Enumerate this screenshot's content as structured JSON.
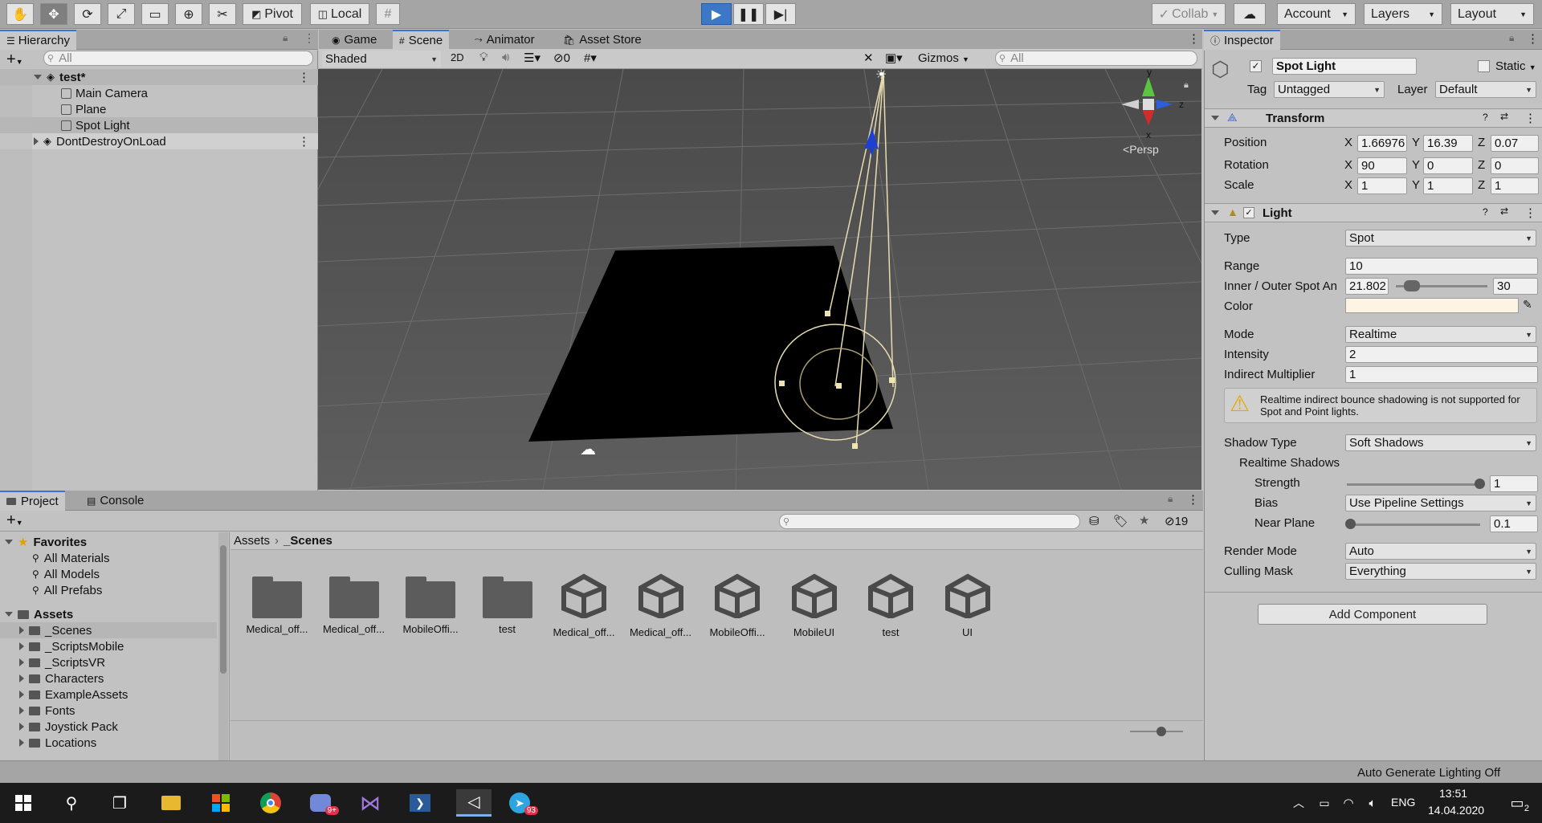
{
  "toolbar": {
    "pivot": "Pivot",
    "local": "Local",
    "collab": "Collab",
    "account": "Account",
    "layers": "Layers",
    "layout": "Layout"
  },
  "hierarchy": {
    "tab": "Hierarchy",
    "search_placeholder": "All",
    "scene": "test*",
    "items": [
      "Main Camera",
      "Plane",
      "Spot Light"
    ],
    "dont_destroy": "DontDestroyOnLoad"
  },
  "scene_view": {
    "tabs": [
      "Game",
      "Scene",
      "Animator",
      "Asset Store"
    ],
    "shading": "Shaded",
    "mode_2d": "2D",
    "hidden_count": "0",
    "gizmos": "Gizmos",
    "search_placeholder": "All",
    "persp": "Persp",
    "axis_labels": [
      "y",
      "z",
      "x"
    ]
  },
  "inspector": {
    "tab": "Inspector",
    "object_name": "Spot Light",
    "static_label": "Static",
    "tag_label": "Tag",
    "tag_value": "Untagged",
    "layer_label": "Layer",
    "layer_value": "Default",
    "transform": {
      "title": "Transform",
      "position_label": "Position",
      "rotation_label": "Rotation",
      "scale_label": "Scale",
      "position": [
        "1.66976",
        "16.39",
        "0.07"
      ],
      "rotation": [
        "90",
        "0",
        "0"
      ],
      "scale": [
        "1",
        "1",
        "1"
      ],
      "axes": [
        "X",
        "Y",
        "Z"
      ]
    },
    "light": {
      "title": "Light",
      "type_label": "Type",
      "type_value": "Spot",
      "range_label": "Range",
      "range_value": "10",
      "spot_label": "Inner / Outer Spot An",
      "inner_value": "21.802",
      "outer_value": "30",
      "color_label": "Color",
      "color_value": "#fdf4e3",
      "mode_label": "Mode",
      "mode_value": "Realtime",
      "intensity_label": "Intensity",
      "intensity_value": "2",
      "indirect_label": "Indirect Multiplier",
      "indirect_value": "1",
      "warning": "Realtime indirect bounce shadowing is not supported for Spot and Point lights.",
      "shadow_type_label": "Shadow Type",
      "shadow_type_value": "Soft Shadows",
      "realtime_shadows_label": "Realtime Shadows",
      "strength_label": "Strength",
      "strength_value": "1",
      "bias_label": "Bias",
      "bias_value": "Use Pipeline Settings",
      "near_plane_label": "Near Plane",
      "near_plane_value": "0.1",
      "render_mode_label": "Render Mode",
      "render_mode_value": "Auto",
      "culling_mask_label": "Culling Mask",
      "culling_mask_value": "Everything"
    },
    "add_component": "Add Component"
  },
  "project": {
    "tabs": [
      "Project",
      "Console"
    ],
    "hidden_count": "19",
    "favorites": "Favorites",
    "favorite_items": [
      "All Materials",
      "All Models",
      "All Prefabs"
    ],
    "assets": "Assets",
    "asset_folders": [
      "_Scenes",
      "_ScriptsMobile",
      "_ScriptsVR",
      "Characters",
      "ExampleAssets",
      "Fonts",
      "Joystick Pack",
      "Locations"
    ],
    "breadcrumb": [
      "Assets",
      "_Scenes"
    ],
    "grid_items": [
      {
        "label": "Medical_off...",
        "kind": "folder"
      },
      {
        "label": "Medical_off...",
        "kind": "folder"
      },
      {
        "label": "MobileOffi...",
        "kind": "folder"
      },
      {
        "label": "test",
        "kind": "folder"
      },
      {
        "label": "Medical_off...",
        "kind": "unity"
      },
      {
        "label": "Medical_off...",
        "kind": "unity"
      },
      {
        "label": "MobileOffi...",
        "kind": "unity"
      },
      {
        "label": "MobileUI",
        "kind": "unity"
      },
      {
        "label": "test",
        "kind": "unity"
      },
      {
        "label": "UI",
        "kind": "unity"
      }
    ]
  },
  "status": {
    "lighting": "Auto Generate Lighting Off"
  },
  "taskbar": {
    "lang": "ENG",
    "time": "13:51",
    "date": "14.04.2020",
    "notifications": "2",
    "discord_badge": "9+",
    "telegram_badge": "93"
  }
}
